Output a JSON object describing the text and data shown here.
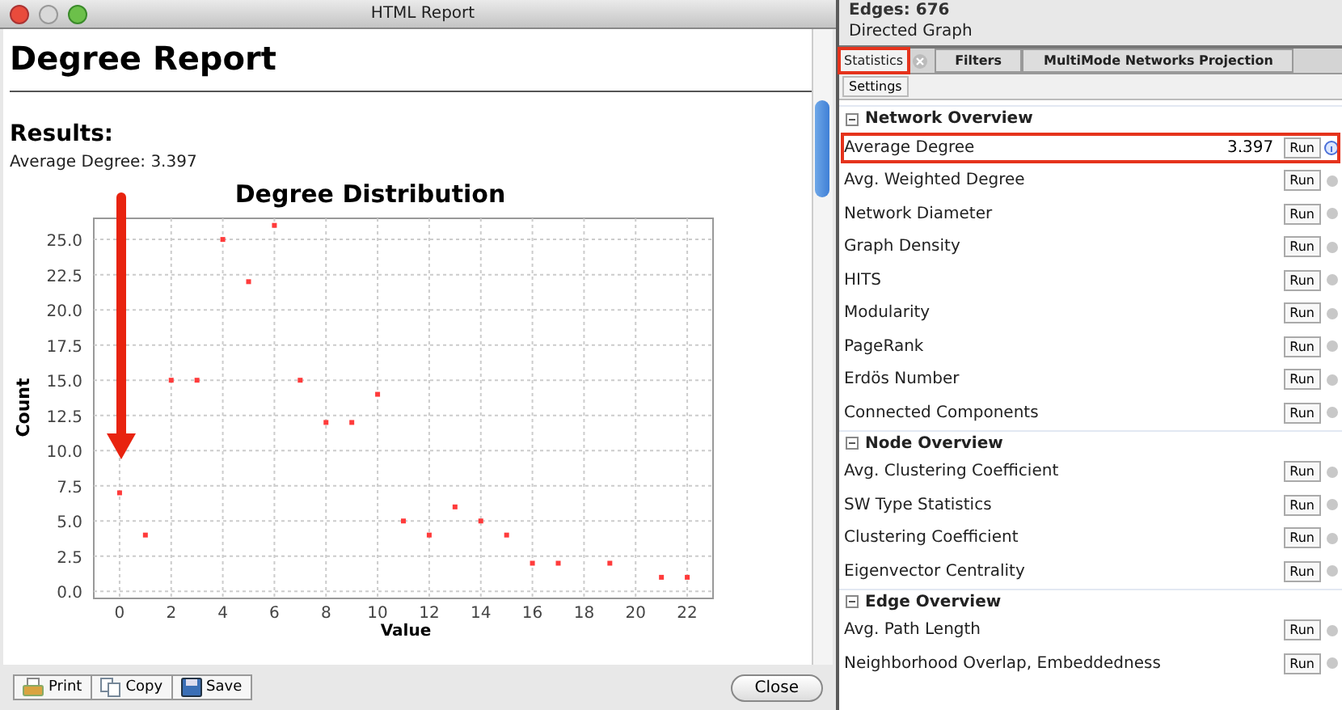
{
  "report_window": {
    "title": "HTML Report",
    "heading": "Degree Report",
    "section": "Results:",
    "summary": "Average Degree: 3.397",
    "chart_data": {
      "type": "scatter",
      "title": "Degree Distribution",
      "xlabel": "Value",
      "ylabel": "Count",
      "xlim": [
        -1,
        23
      ],
      "ylim": [
        -0.5,
        26.5
      ],
      "xticks": [
        0,
        2,
        4,
        6,
        8,
        10,
        12,
        14,
        16,
        18,
        20,
        22
      ],
      "yticks": [
        {
          "value": 0,
          "label": "0.0"
        },
        {
          "value": 2.5,
          "label": "2.5"
        },
        {
          "value": 5,
          "label": "5.0"
        },
        {
          "value": 7.5,
          "label": "7.5"
        },
        {
          "value": 10,
          "label": "10.0"
        },
        {
          "value": 12.5,
          "label": "12.5"
        },
        {
          "value": 15,
          "label": "15.0"
        },
        {
          "value": 17.5,
          "label": "17.5"
        },
        {
          "value": 20,
          "label": "20.0"
        },
        {
          "value": 22.5,
          "label": "22.5"
        },
        {
          "value": 25,
          "label": "25.0"
        }
      ],
      "x": [
        0,
        1,
        2,
        3,
        4,
        5,
        6,
        7,
        8,
        9,
        10,
        11,
        12,
        13,
        14,
        15,
        16,
        17,
        19,
        21,
        22
      ],
      "grid": true,
      "series": [
        {
          "color": "#ff3b3b",
          "values": [
            7,
            4,
            15,
            15,
            25,
            22,
            26,
            15,
            12,
            12,
            14,
            5,
            4,
            6,
            5,
            4,
            2,
            2,
            2,
            1,
            1
          ]
        }
      ]
    },
    "toolbar": [
      {
        "label": "Print",
        "kind": "print"
      },
      {
        "label": "Copy",
        "kind": "copy"
      },
      {
        "label": "Save",
        "kind": "save"
      }
    ],
    "close_button": "Close"
  },
  "graph_info": {
    "edges": "Edges: 676",
    "type": "Directed Graph"
  },
  "tabs": [
    {
      "label": "Statistics",
      "selected": true,
      "highlighted": true,
      "closable": true
    },
    {
      "label": "Filters",
      "selected": false,
      "highlighted": false,
      "closable": false
    },
    {
      "label": "MultiMode Networks Projection",
      "selected": false,
      "highlighted": false,
      "closable": false
    }
  ],
  "settings_button": "Settings",
  "groups": [
    {
      "title": "Network Overview",
      "items": [
        {
          "name": "Average Degree",
          "value": "3.397",
          "run": "Run",
          "completed": true,
          "highlighted": true
        },
        {
          "name": "Avg. Weighted Degree",
          "run": "Run",
          "completed": false,
          "highlighted": false
        },
        {
          "name": "Network Diameter",
          "run": "Run",
          "completed": false,
          "highlighted": false
        },
        {
          "name": "Graph Density",
          "run": "Run",
          "completed": false,
          "highlighted": false
        },
        {
          "name": "HITS",
          "run": "Run",
          "completed": false,
          "highlighted": false
        },
        {
          "name": "Modularity",
          "run": "Run",
          "completed": false,
          "highlighted": false
        },
        {
          "name": "PageRank",
          "run": "Run",
          "completed": false,
          "highlighted": false
        },
        {
          "name": "Erdös Number",
          "run": "Run",
          "completed": false,
          "highlighted": false
        },
        {
          "name": "Connected Components",
          "run": "Run",
          "completed": false,
          "highlighted": false
        }
      ]
    },
    {
      "title": "Node Overview",
      "items": [
        {
          "name": "Avg. Clustering Coefficient",
          "run": "Run",
          "completed": false,
          "highlighted": false
        },
        {
          "name": "SW Type Statistics",
          "run": "Run",
          "completed": false,
          "highlighted": false
        },
        {
          "name": "Clustering Coefficient",
          "run": "Run",
          "completed": false,
          "highlighted": false
        },
        {
          "name": "Eigenvector Centrality",
          "run": "Run",
          "completed": false,
          "highlighted": false
        }
      ]
    },
    {
      "title": "Edge Overview",
      "items": [
        {
          "name": "Avg. Path Length",
          "run": "Run",
          "completed": false,
          "highlighted": false
        },
        {
          "name": "Neighborhood Overlap, Embeddedness",
          "run": "Run",
          "completed": false,
          "highlighted": false
        }
      ]
    }
  ]
}
